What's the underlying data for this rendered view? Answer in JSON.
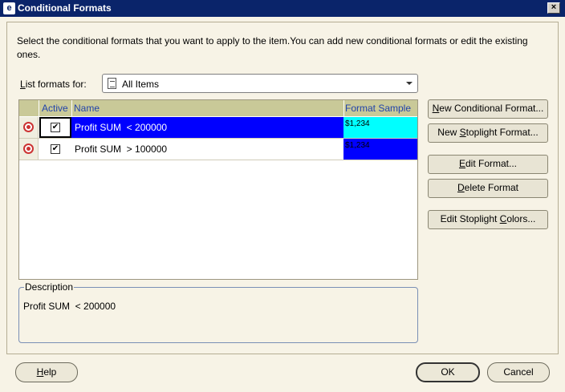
{
  "window": {
    "title": "Conditional Formats",
    "icon": "app-icon",
    "close_label": "×"
  },
  "intro_text": "Select the conditional formats that you want to apply to the item.You can add new conditional formats or edit the existing ones.",
  "list_formats": {
    "label_prefix": "L",
    "label_rest": "ist formats for:",
    "selected": "All Items"
  },
  "grid": {
    "columns": {
      "active": "Active",
      "name": "Name",
      "sample": "Format Sample"
    },
    "rows": [
      {
        "active": true,
        "name": "Profit SUM  < 200000",
        "sample_text": "$1,234",
        "sample_bg": "#00ffff",
        "sample_fg": "#000000",
        "selected": true
      },
      {
        "active": true,
        "name": "Profit SUM  > 100000",
        "sample_text": "$1,234",
        "sample_bg": "#0000ff",
        "sample_fg": "#000000",
        "selected": false
      }
    ],
    "selected_row_color": "#0000ff"
  },
  "buttons": {
    "new_conditional": {
      "pre": "",
      "u": "N",
      "post": "ew Conditional Format..."
    },
    "new_stoplight": {
      "pre": "New ",
      "u": "S",
      "post": "toplight Format..."
    },
    "edit_format": {
      "pre": "",
      "u": "E",
      "post": "dit Format..."
    },
    "delete_format": {
      "pre": "",
      "u": "D",
      "post": "elete Format"
    },
    "edit_stoplight_colors": {
      "pre": "Edit Stoplight ",
      "u": "C",
      "post": "olors..."
    }
  },
  "description": {
    "legend": "Description",
    "text": "Profit SUM  < 200000"
  },
  "footer": {
    "help": {
      "u": "H",
      "post": "elp"
    },
    "ok": "OK",
    "cancel": "Cancel"
  }
}
